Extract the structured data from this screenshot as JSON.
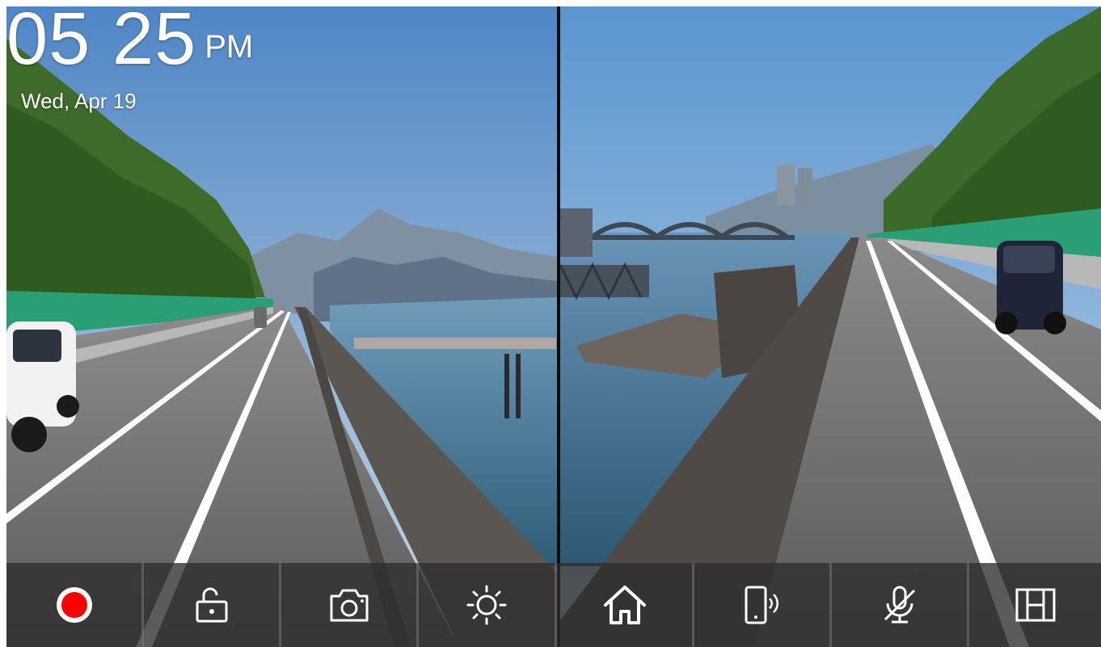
{
  "clock": {
    "time": "05 25",
    "ampm": "PM",
    "date": "Wed, Apr 19"
  },
  "cameras": {
    "front": "front-camera-view",
    "rear": "rear-camera-view"
  },
  "toolbar": {
    "buttons": [
      {
        "name": "record-button",
        "icon": "record-icon",
        "color": "#ff0000"
      },
      {
        "name": "lock-button",
        "icon": "unlock-icon"
      },
      {
        "name": "snapshot-button",
        "icon": "camera-icon"
      },
      {
        "name": "brightness-button",
        "icon": "sun-icon"
      },
      {
        "name": "home-button",
        "icon": "home-icon"
      },
      {
        "name": "phone-connect-button",
        "icon": "phone-signal-icon"
      },
      {
        "name": "mic-mute-button",
        "icon": "mic-off-icon"
      },
      {
        "name": "split-view-button",
        "icon": "split-screen-icon"
      }
    ]
  },
  "colors": {
    "record": "#ff0000",
    "toolbar_bg": "#2d2d2d",
    "icon": "#ffffff"
  }
}
